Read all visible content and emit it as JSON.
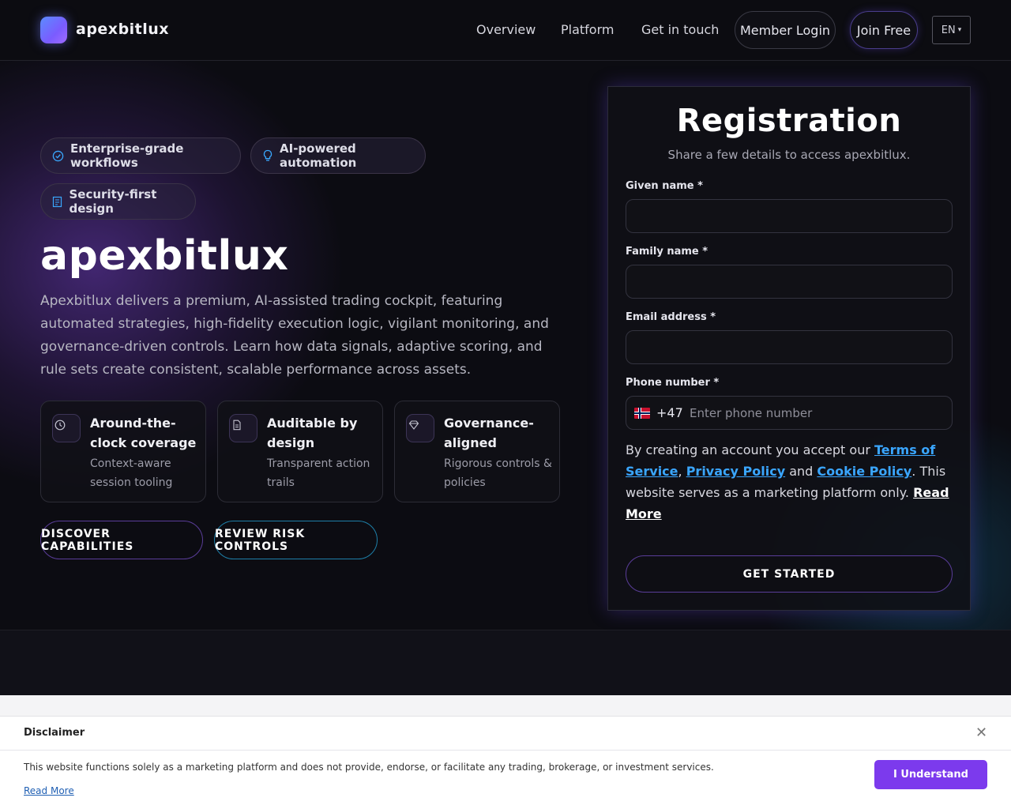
{
  "header": {
    "brand": "apexbitlux",
    "nav": [
      "Overview",
      "Platform",
      "Get in touch"
    ],
    "login": "Member Login",
    "join": "Join Free",
    "language": "EN",
    "language_caret": "▾"
  },
  "hero": {
    "badges": [
      {
        "label": "Enterprise-grade workflows",
        "icon": "check-circle-icon"
      },
      {
        "label": "AI-powered automation",
        "icon": "lightbulb-icon"
      },
      {
        "label": "Security-first design",
        "icon": "shield-icon"
      }
    ],
    "title": "apexbitlux",
    "description": "Apexbitlux delivers a premium, AI-assisted trading cockpit, featuring automated strategies, high-fidelity execution logic, vigilant monitoring, and governance-driven controls. Learn how data signals, adaptive scoring, and rule sets create consistent, scalable performance across assets.",
    "features": [
      {
        "title": "Around-the-clock coverage",
        "subtitle": "Context-aware session tooling",
        "icon": "clock-icon"
      },
      {
        "title": "Auditable by design",
        "subtitle": "Transparent action trails",
        "icon": "document-icon"
      },
      {
        "title": "Governance-aligned",
        "subtitle": "Rigorous controls & policies",
        "icon": "diamond-icon"
      }
    ],
    "cta_primary": "DISCOVER CAPABILITIES",
    "cta_secondary": "REVIEW RISK CONTROLS"
  },
  "form": {
    "title": "Registration",
    "subtitle": "Share a few details to access apexbitlux.",
    "given_name_label": "Given name *",
    "family_name_label": "Family name *",
    "email_label": "Email address *",
    "phone_label": "Phone number *",
    "phone_dial_code": "+47",
    "phone_placeholder": "Enter phone number",
    "terms_prefix": "By creating an account you accept our ",
    "terms_link": "Terms of Service",
    "comma": ",",
    "privacy_link": "Privacy Policy",
    "and": " and ",
    "cookie_link": "Cookie Policy",
    "terms_suffix": ". This website serves as a marketing platform only. ",
    "read_more": "Read More",
    "submit": "GET STARTED"
  },
  "disclaimer": {
    "title": "Disclaimer",
    "text": "This website functions solely as a marketing platform and does not provide, endorse, or facilitate any trading, brokerage, or investment services.",
    "read_more": "Read More",
    "button": "I Understand",
    "close": "✕"
  },
  "colors": {
    "accent_purple": "#7c3aed",
    "link_blue": "#3aa6ff",
    "background": "#0b0b10"
  }
}
